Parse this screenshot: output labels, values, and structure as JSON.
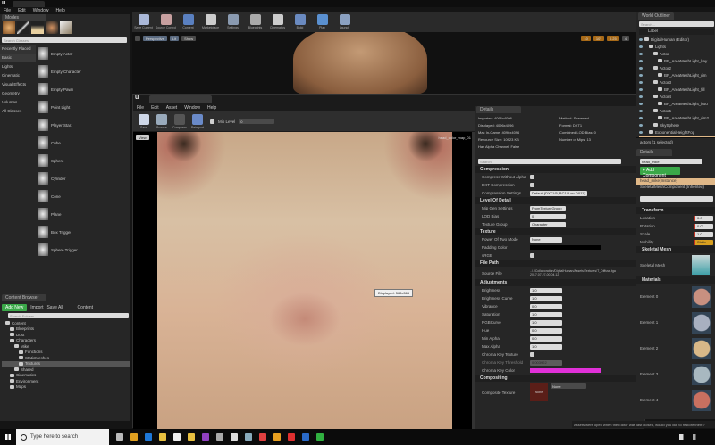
{
  "app": {
    "menu": [
      "File",
      "Edit",
      "Window",
      "Help"
    ]
  },
  "modes": {
    "search_placeholder": "Search Classes",
    "categories": [
      "Recently Placed",
      "Basic",
      "Lights",
      "Cinematic",
      "Visual Effects",
      "Geometry",
      "Volumes",
      "All Classes"
    ],
    "selected": 1,
    "items": [
      "Empty Actor",
      "Empty Character",
      "Empty Pawn",
      "Point Light",
      "Player Start",
      "Cube",
      "Sphere",
      "Cylinder",
      "Cone",
      "Plane",
      "Box Trigger",
      "Sphere Trigger"
    ]
  },
  "toolbar": [
    "Save Current",
    "Source Control",
    "Content",
    "Marketplace",
    "Settings",
    "Blueprints",
    "Cinematics",
    "Build",
    "Play",
    "Launch"
  ],
  "viewport": {
    "perspective": "Perspective",
    "lit": "Lit",
    "show": "Show",
    "grid": "10",
    "angle": "10°",
    "scale": "0.25",
    "cam": "4"
  },
  "texture_editor": {
    "menu": [
      "File",
      "Edit",
      "Asset",
      "Window",
      "Help"
    ],
    "toolbar": [
      "Save",
      "Browse",
      "Compress",
      "Reimport"
    ],
    "mip_label": "Mip Level",
    "mip_value": "0",
    "view_label": "View",
    "texture_name": "head_color_map_01",
    "tooltip": "Displayed: 566x566"
  },
  "details": {
    "tab": "Details",
    "info_left": [
      "Imported: 4096x4096",
      "Displayed: 4096x4096",
      "Max In-Game: 4096x4096",
      "Resource Size: 10923 KB",
      "Has Alpha Channel: False"
    ],
    "info_right": [
      "Method: Streamed",
      "Format: DXT1",
      "Combined LOD Bias: 0",
      "Number of Mips: 13"
    ],
    "search_placeholder": "Search",
    "compression": {
      "title": "Compression",
      "rows": [
        "Compress Without Alpha",
        "DXT Compression",
        "Compression Settings"
      ],
      "settings_value": "Default (DXT1/5, BC1/3 on DX11)"
    },
    "lod": {
      "title": "Level Of Detail",
      "rows": [
        "Mip Gen Settings",
        "LOD Bias",
        "Texture Group"
      ],
      "values": [
        "FromTextureGroup",
        "0",
        "Character"
      ]
    },
    "texture": {
      "title": "Texture",
      "rows": [
        "Power Of Two Mode",
        "Padding Color",
        "sRGB"
      ],
      "pot_value": "None"
    },
    "file_path": {
      "title": "File Path",
      "label": "Source File",
      "value": "../../Collaboration/DigitalHuman/Assets/Textures/T_Diffuse.tga",
      "timestamp": "2017.07.27-00.04.12"
    },
    "adjustments": {
      "title": "Adjustments",
      "rows": [
        {
          "label": "Brightness",
          "value": "1.0"
        },
        {
          "label": "Brightness Curve",
          "value": "1.0"
        },
        {
          "label": "Vibrance",
          "value": "0.0"
        },
        {
          "label": "Saturation",
          "value": "1.0"
        },
        {
          "label": "RGBCurve",
          "value": "1.0"
        },
        {
          "label": "Hue",
          "value": "0.0"
        },
        {
          "label": "Min Alpha",
          "value": "0.0"
        },
        {
          "label": "Max Alpha",
          "value": "1.0"
        }
      ],
      "chroma_key": "Chroma Key Texture",
      "chroma_threshold": "Chroma Key Threshold",
      "chroma_threshold_value": "0.003922",
      "chroma_color": "Chroma Key Color",
      "chroma_color_hex": "#e030d8"
    },
    "compositing": {
      "title": "Compositing",
      "label": "Composite Texture",
      "thumb": "None",
      "value": "None"
    }
  },
  "outliner": {
    "tab": "World Outliner",
    "search_placeholder": "Search...",
    "column": "Label",
    "items": [
      {
        "t": "DigitalHuman (Editor)",
        "d": 0
      },
      {
        "t": "Lights",
        "d": 1
      },
      {
        "t": "Actor",
        "d": 2
      },
      {
        "t": "BP_AreaMeshLight_key",
        "d": 3
      },
      {
        "t": "Actor2",
        "d": 2
      },
      {
        "t": "BP_AreaMeshLight_rim",
        "d": 3
      },
      {
        "t": "Actor3",
        "d": 2
      },
      {
        "t": "BP_AreaMeshLight_fill",
        "d": 3
      },
      {
        "t": "Actor4",
        "d": 2
      },
      {
        "t": "BP_AreaMeshLight_bou",
        "d": 3
      },
      {
        "t": "Actor5",
        "d": 2
      },
      {
        "t": "BP_AreaMeshLight_rim2",
        "d": 3
      },
      {
        "t": "SkySphere",
        "d": 2
      },
      {
        "t": "ExponentialHeightFog",
        "d": 1
      },
      {
        "t": "head_mike",
        "d": 1
      }
    ],
    "count": "actors (1 selected)"
  },
  "right_details": {
    "name": "head_mike",
    "add_component": "+ Add Component",
    "instance": "head_mike(Instance)",
    "component": "SkeletalMeshComponent (Inherited)",
    "transform_title": "Transform",
    "transform": [
      {
        "l": "Location",
        "v": "0.0"
      },
      {
        "l": "Rotation",
        "v": "0.0°"
      },
      {
        "l": "Scale",
        "v": "1.0"
      },
      {
        "l": "Mobility",
        "v": "Static"
      }
    ],
    "mesh_title": "Skeletal Mesh",
    "mesh_label": "Skeletal Mesh",
    "materials_title": "Materials",
    "elements": [
      "Element 0",
      "Element 1",
      "Element 2",
      "Element 3",
      "Element 4"
    ]
  },
  "content_browser": {
    "tab": "Content Browser",
    "add_new": "Add New",
    "import": "Import",
    "save_all": "Save All",
    "content": "Content",
    "search_placeholder": "Search Folders",
    "tree": [
      {
        "t": "Content",
        "d": 0
      },
      {
        "t": "Blueprints",
        "d": 1
      },
      {
        "t": "Dust",
        "d": 1
      },
      {
        "t": "Characters",
        "d": 1
      },
      {
        "t": "Mike",
        "d": 2
      },
      {
        "t": "Functions",
        "d": 3
      },
      {
        "t": "StaticMeshes",
        "d": 3
      },
      {
        "t": "Textures",
        "d": 3
      },
      {
        "t": "Shared",
        "d": 2
      },
      {
        "t": "Cinematics",
        "d": 1
      },
      {
        "t": "Environment",
        "d": 1
      },
      {
        "t": "Maps",
        "d": 1
      }
    ],
    "selected": 7
  },
  "notification": "Assets were open when the Editor was last closed, would you like to restore them?",
  "taskbar": {
    "search_placeholder": "Type here to search",
    "apps": [
      "task-view",
      "chrome",
      "edge",
      "file-explorer",
      "mail",
      "store",
      "onenote",
      "app",
      "unreal",
      "app2",
      "app3",
      "app4",
      "acrobat",
      "photoshop",
      "camtasia"
    ]
  }
}
